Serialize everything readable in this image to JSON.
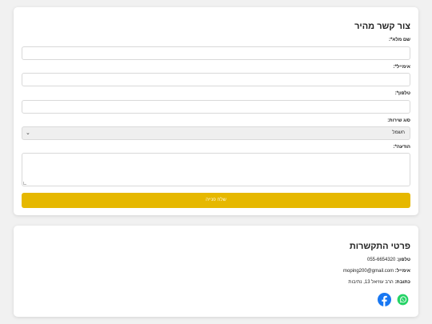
{
  "form": {
    "title": "צור קשר מהיר",
    "name_label": "שם מלא*:",
    "email_label": "אימייל*:",
    "phone_label": "טלפון*:",
    "service_label": "סוג שירות:",
    "service_selected": "חשמל",
    "message_label": "הודעה*:",
    "submit_label": "שלח פנייה"
  },
  "contact": {
    "title": "פרטי התקשרות",
    "phone_label": "טלפון:",
    "phone_value": "055-6654320",
    "email_label": "אימייל:",
    "email_value": "moping200@gmail.com",
    "address_label": "כתובת:",
    "address_value": "הרב עוזיאל 13, נתיבות"
  },
  "icons": {
    "whatsapp": "whatsapp-icon",
    "facebook": "facebook-icon"
  },
  "colors": {
    "accent": "#e6b800",
    "whatsapp": "#25d366",
    "facebook": "#1877f2"
  }
}
